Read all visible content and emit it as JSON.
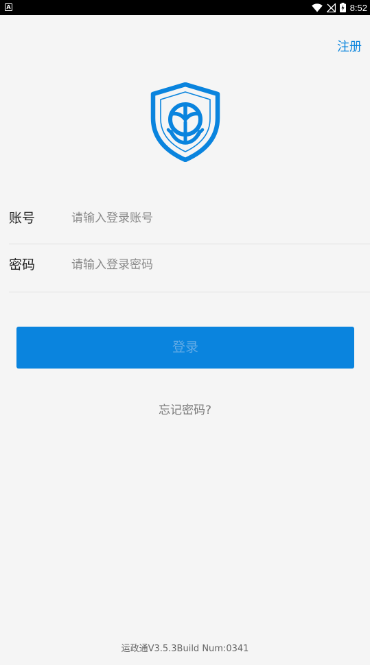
{
  "status_bar": {
    "left_icon": "A",
    "time": "8:52",
    "icons": [
      "wifi-icon",
      "signal-off-icon",
      "battery-charging-icon"
    ]
  },
  "header": {
    "register_label": "注册"
  },
  "logo": {
    "icon": "shield-anchor-logo",
    "color": "#0a84de"
  },
  "form": {
    "account": {
      "label": "账号",
      "placeholder": "请输入登录账号",
      "value": ""
    },
    "password": {
      "label": "密码",
      "placeholder": "请输入登录密码",
      "value": ""
    }
  },
  "actions": {
    "login_label": "登录",
    "forgot_label": "忘记密码?"
  },
  "footer": {
    "version": "运政通V3.5.3Build Num:0341"
  },
  "colors": {
    "accent": "#0a84de",
    "background": "#f5f5f5"
  }
}
